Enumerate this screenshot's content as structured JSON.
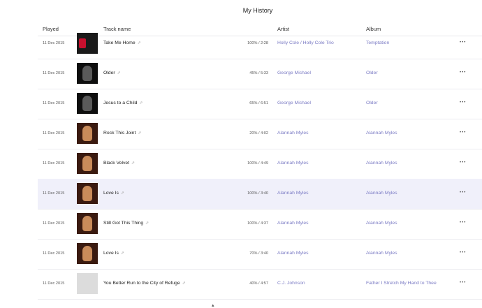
{
  "page": {
    "title": "My History"
  },
  "columns": {
    "played": "Played",
    "track": "Track name",
    "artist": "Artist",
    "album": "Album"
  },
  "rows": [
    {
      "played": "11 Dec 2015",
      "track": "Take Me Home",
      "progress": "100% / 2:28",
      "artist": "Holly Cole / Holly Cole Trio",
      "album": "Temptation",
      "thumb": "holly",
      "highlight": false
    },
    {
      "played": "11 Dec 2015",
      "track": "Older",
      "progress": "45% / 5:33",
      "artist": "George Michael",
      "album": "Older",
      "thumb": "george",
      "highlight": false
    },
    {
      "played": "11 Dec 2015",
      "track": "Jesus to a Child",
      "progress": "65% / 6:51",
      "artist": "George Michael",
      "album": "Older",
      "thumb": "george",
      "highlight": false
    },
    {
      "played": "11 Dec 2015",
      "track": "Rock This Joint",
      "progress": "20% / 4:02",
      "artist": "Alannah Myles",
      "album": "Alannah Myles",
      "thumb": "alannah",
      "highlight": false
    },
    {
      "played": "11 Dec 2015",
      "track": "Black Velvet",
      "progress": "100% / 4:49",
      "artist": "Alannah Myles",
      "album": "Alannah Myles",
      "thumb": "alannah",
      "highlight": false
    },
    {
      "played": "11 Dec 2015",
      "track": "Love Is",
      "progress": "100% / 3:40",
      "artist": "Alannah Myles",
      "album": "Alannah Myles",
      "thumb": "alannah",
      "highlight": true
    },
    {
      "played": "11 Dec 2015",
      "track": "Still Got This Thing",
      "progress": "100% / 4:37",
      "artist": "Alannah Myles",
      "album": "Alannah Myles",
      "thumb": "alannah",
      "highlight": false
    },
    {
      "played": "11 Dec 2015",
      "track": "Love Is",
      "progress": "70% / 3:40",
      "artist": "Alannah Myles",
      "album": "Alannah Myles",
      "thumb": "alannah",
      "highlight": false
    },
    {
      "played": "11 Dec 2015",
      "track": "You Better Run to the City of Refuge",
      "progress": "40% / 4:57",
      "artist": "C.J. Johnson",
      "album": "Father I Stretch My Hand to Thee",
      "thumb": "placeholder",
      "highlight": false
    }
  ],
  "icons": {
    "more": "more-horizontal-icon",
    "tag": "tag-icon",
    "scroll": "chevron-up-icon"
  },
  "colors": {
    "link": "#7b7bc4",
    "highlight_row": "#f0f0fa"
  }
}
